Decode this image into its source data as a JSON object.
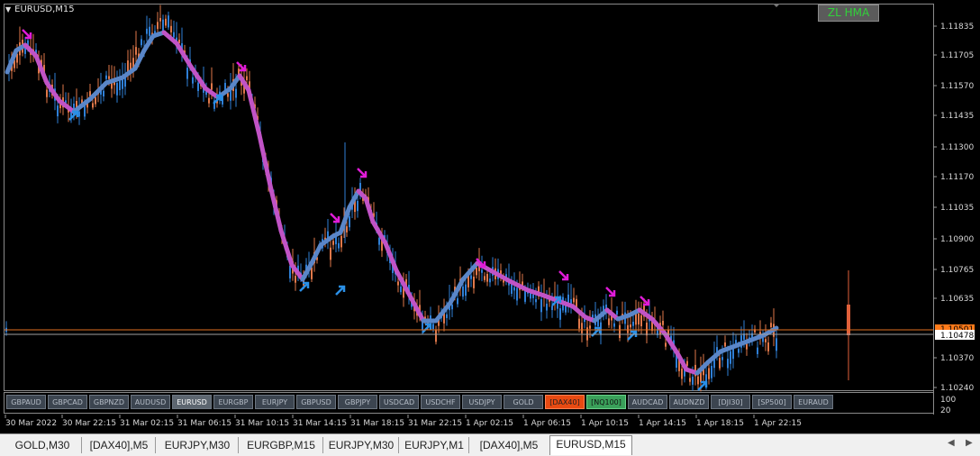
{
  "window": {
    "symbol_title": "EURUSD,M15",
    "indicator_badge": "ZL HMA"
  },
  "colors": {
    "bull": "#2f7fd6",
    "bear": "#e0784a",
    "hma_up": "#5a86c8",
    "hma_down": "#c153c6",
    "arrow_up": "#2a8fe6",
    "arrow_down": "#e01bd8",
    "price_line": "#e07020",
    "current_price_bg": "#ff7a1a",
    "grid": "#444444"
  },
  "price_axis": {
    "labels": [
      "1.11835",
      "1.11705",
      "1.11570",
      "1.11435",
      "1.11300",
      "1.11170",
      "1.11035",
      "1.10900",
      "1.10765",
      "1.10635",
      "1.10370",
      "1.10240"
    ],
    "current_price": "1.10478",
    "bid_label": "1.10501"
  },
  "sub_axis": {
    "labels": [
      "100",
      "20"
    ]
  },
  "time_axis": {
    "labels": [
      "30 Mar 2022",
      "30 Mar 22:15",
      "31 Mar 02:15",
      "31 Mar 06:15",
      "31 Mar 10:15",
      "31 Mar 14:15",
      "31 Mar 18:15",
      "31 Mar 22:15",
      "1 Apr 02:15",
      "1 Apr 06:15",
      "1 Apr 10:15",
      "1 Apr 14:15",
      "1 Apr 18:15",
      "1 Apr 22:15"
    ]
  },
  "symbol_buttons": [
    {
      "label": "GBPAUD",
      "state": "normal"
    },
    {
      "label": "GBPCAD",
      "state": "normal"
    },
    {
      "label": "GBPNZD",
      "state": "normal"
    },
    {
      "label": "AUDUSD",
      "state": "normal"
    },
    {
      "label": "EURUSD",
      "state": "selected"
    },
    {
      "label": "EURGBP",
      "state": "normal"
    },
    {
      "label": "EURJPY",
      "state": "normal"
    },
    {
      "label": "GBPUSD",
      "state": "normal"
    },
    {
      "label": "GBPJPY",
      "state": "normal"
    },
    {
      "label": "USDCAD",
      "state": "normal"
    },
    {
      "label": "USDCHF",
      "state": "normal"
    },
    {
      "label": "USDJPY",
      "state": "normal"
    },
    {
      "label": "GOLD",
      "state": "normal"
    },
    {
      "label": "[DAX40]",
      "state": "red"
    },
    {
      "label": "[NQ100]",
      "state": "green"
    },
    {
      "label": "AUDCAD",
      "state": "normal"
    },
    {
      "label": "AUDNZD",
      "state": "normal"
    },
    {
      "label": "[DJI30]",
      "state": "normal"
    },
    {
      "label": "[SP500]",
      "state": "normal"
    },
    {
      "label": "EURAUD",
      "state": "normal"
    }
  ],
  "tabs": [
    {
      "label": "GOLD,M30",
      "active": false
    },
    {
      "label": "[DAX40],M5",
      "active": false
    },
    {
      "label": "EURJPY,M30",
      "active": false
    },
    {
      "label": "EURGBP,M15",
      "active": false
    },
    {
      "label": "EURJPY,M30",
      "active": false
    },
    {
      "label": "EURJPY,M1",
      "active": false
    },
    {
      "label": "[DAX40],M5",
      "active": false
    },
    {
      "label": "EURUSD,M15",
      "active": true
    }
  ],
  "icons": {
    "menu_triangle": "triangle-down-icon",
    "scroll_left": "arrow-left-icon",
    "scroll_right": "arrow-right-icon"
  }
}
